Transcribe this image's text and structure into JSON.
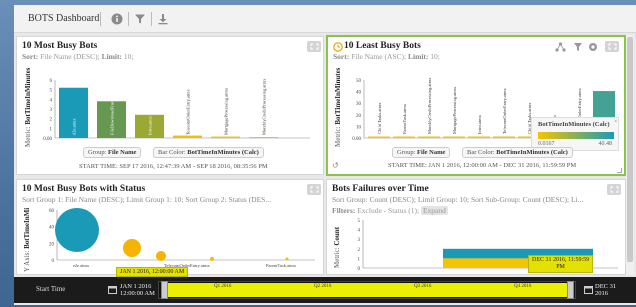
{
  "header": {
    "title": "BOTS Dashboard",
    "icons": [
      "info-icon",
      "filter-icon",
      "download-icon"
    ]
  },
  "panels": {
    "most_busy": {
      "title": "10 Most Busy Bots",
      "sort_label": "Sort:",
      "sort_value": "File Name (DESC);",
      "limit_label": "Limit:",
      "limit_value": "10;",
      "ylabel_metric": "Metric:",
      "ylabel_value": "BotTimeInMinutes",
      "group_label": "Group:",
      "group_value": "File Name",
      "barcolor_label": "Bar Color:",
      "barcolor_value": "BotTimeInMinutes (Calc)",
      "start_time": "START TIME: SEP 17 2016, 12:47:39 AM - SEP 18 2016, 08:35:56 PM"
    },
    "least_busy": {
      "title": "10 Least Busy Bots",
      "sort_label": "Sort:",
      "sort_value": "File Name (ASC);",
      "limit_label": "Limit:",
      "limit_value": "10;",
      "ylabel_metric": "Metric:",
      "ylabel_value": "BotTimeInMinutes",
      "group_label": "Group:",
      "group_value": "File Name",
      "barcolor_label": "Bar Color:",
      "barcolor_value": "BotTimeInMinutes (Calc)",
      "start_time": "START TIME: JAN 1 2016, 12:00:00 AM - DEC 31 2016, 11:59:59 PM",
      "legend_title": "BotTimeInMinutes (Calc)",
      "legend_min": "0.0167",
      "legend_max": "40.48"
    },
    "busy_status": {
      "title": "10 Most Busy Bots with Status",
      "sort_text": "Sort Group 1: File Name (DESC); Limit Group 1: 10; Sort Group 2: Status (DES...",
      "ylabel_axis": "Y Axis:",
      "ylabel_value": "BotTimeInMi"
    },
    "failures": {
      "title": "Bots Failures over Time",
      "sort_text": "Sort Group: Count (DESC); Limit Group: 10; Sort Sub-Group: Count (DESC); Li...",
      "filters_label": "Filters:",
      "filters_value": "Exclude - Status (1);",
      "expand_label": "Expand",
      "ylabel_metric": "Metric:",
      "ylabel_value": "Count"
    }
  },
  "timeline": {
    "label": "Start Time",
    "start_date_line1": "JAN 1 2016",
    "start_date_line2": "12:00:00 AM",
    "end_date_line1": "DEC 31",
    "end_date_line2": "2016",
    "quarters": [
      "Q1 2016",
      "Q2 2016",
      "Q3 2016",
      "Q4 2016"
    ],
    "tip_start": "JAN 1 2016, 12:00:00 AM",
    "tip_end_line1": "DEC 31 2016, 11:59:59",
    "tip_end_line2": "PM"
  },
  "colors": {
    "accent_green": "#8bc34a",
    "teal": "#1a9ab7",
    "yellow": "#f5c400",
    "timeline_yellow": "#eaf000"
  },
  "chart_data": [
    {
      "type": "bar",
      "title": "10 Most Busy Bots",
      "categories": [
        "d2e.atmx",
        "FileDownloadFromS...",
        "Intro.atmx",
        "TelecomOrderEntry.atmx",
        "MortgageProcessing.atmx",
        "MonthlyCreditProcessing.atmx"
      ],
      "values": [
        5.2,
        3.8,
        2.4,
        0.25,
        0.15,
        0.1
      ],
      "ylim": [
        0,
        6
      ],
      "yticks": [
        "0.00",
        "1",
        "2",
        "3",
        "4",
        "5",
        "6"
      ]
    },
    {
      "type": "bar",
      "title": "10 Least Busy Bots",
      "categories": [
        "Child Tasks.atmx",
        "ParentTask.atmx",
        "MonthlyCreditProcessing.atmx",
        "MortgageProcessing.atmx",
        "Intro.atmx",
        "TelecomOrderEntry.atmx",
        "Child Tasks.atmx",
        "Intro.atmx",
        "TelecomOrderEntry.atmx",
        "d2e.atmx"
      ],
      "values": [
        0.3,
        0.3,
        0.4,
        0.4,
        0.5,
        0.6,
        0.7,
        0.8,
        1.0,
        40.48
      ],
      "ylim": [
        0,
        50
      ],
      "yticks": [
        "0.00",
        "10",
        "20",
        "30",
        "40",
        "50"
      ]
    },
    {
      "type": "scatter",
      "title": "10 Most Busy Bots with Status",
      "categories": [
        "e2e.atmx",
        "TelecomOrderEntry.atmx",
        "ParentTask.atmx"
      ],
      "yticks": [
        "0",
        "20",
        "40",
        "60"
      ],
      "ylim": [
        0,
        70
      ]
    },
    {
      "type": "bar",
      "title": "Bots Failures over Time",
      "yticks": [
        "0",
        "1",
        "2",
        "3",
        "4",
        "5"
      ],
      "ylim": [
        0,
        5
      ],
      "values": [
        2
      ]
    }
  ]
}
